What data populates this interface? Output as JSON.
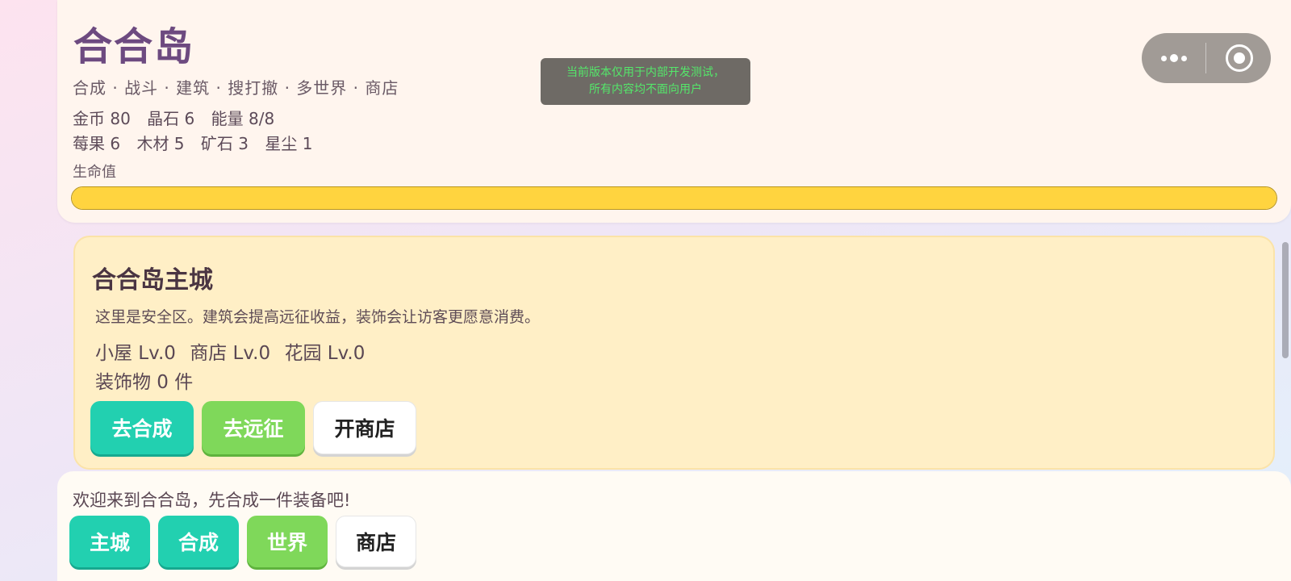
{
  "header": {
    "title": "合合岛",
    "tagline": "合成 · 战斗 · 建筑 · 搜打撤 · 多世界 · 商店",
    "resources_row1": [
      "金币 80",
      "晶石 6",
      "能量 8/8"
    ],
    "resources_row2": [
      "莓果 6",
      "木材 5",
      "矿石 3",
      "星尘 1"
    ],
    "hp_label": "生命值",
    "hp_fraction": 1.0,
    "hp_color": "#ffd43f"
  },
  "toast": {
    "line1": "当前版本仅用于内部开发测试，",
    "line2": "所有内容均不面向用户"
  },
  "capsule": {
    "more_icon": "more-dots-icon",
    "close_icon": "target-close-icon"
  },
  "city": {
    "title": "合合岛主城",
    "description": "这里是安全区。建筑会提高远征收益，装饰会让访客更愿意消费。",
    "buildings": [
      "小屋 Lv.0",
      "商店 Lv.0",
      "花园 Lv.0"
    ],
    "decorations": "装饰物 0 件",
    "buttons": {
      "merge": "去合成",
      "expedition": "去远征",
      "open_shop": "开商店"
    }
  },
  "bottom": {
    "welcome": "欢迎来到合合岛，先合成一件装备吧!",
    "nav": {
      "city": "主城",
      "merge": "合成",
      "world": "世界",
      "shop": "商店"
    }
  },
  "colors": {
    "teal": "#22d0b0",
    "green": "#7fd85a",
    "title_purple": "#6d4a80",
    "card_yellow": "#ffefc6"
  }
}
